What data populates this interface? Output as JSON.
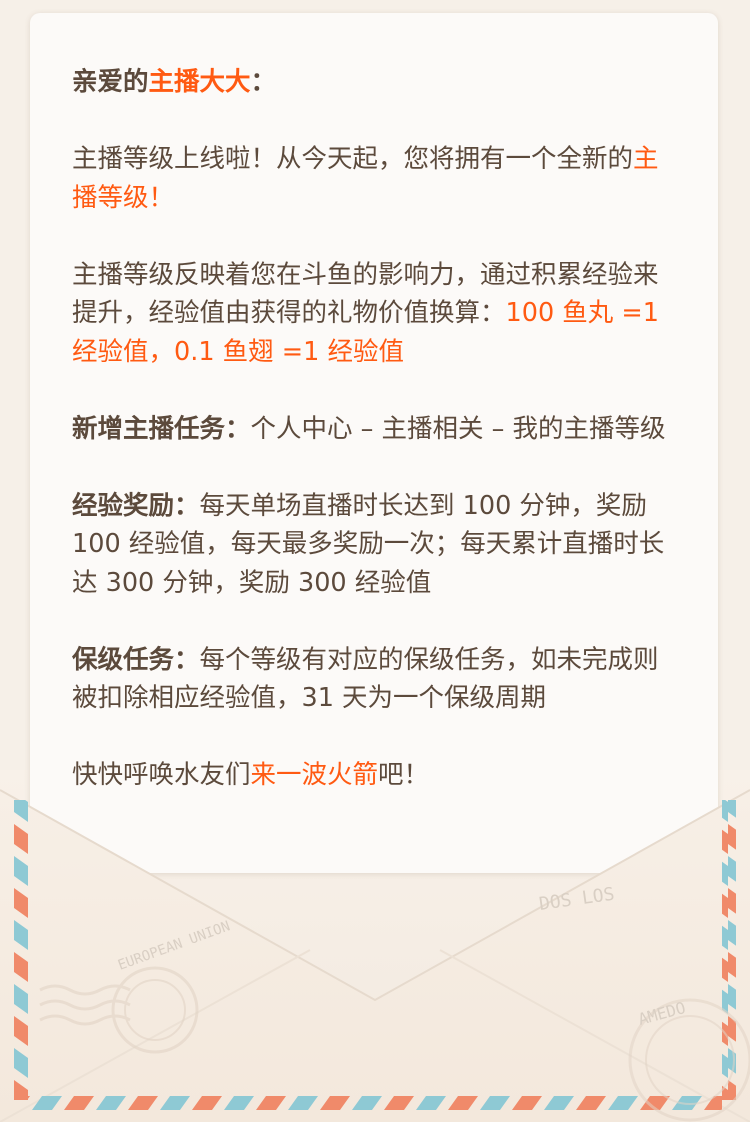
{
  "greeting": {
    "prefix": "亲爱的",
    "highlight": "主播大大",
    "suffix": "："
  },
  "intro": {
    "text": "主播等级上线啦！从今天起，您将拥有一个全新的",
    "highlight": "主播等级",
    "suffix": "！"
  },
  "explain": {
    "text": "主播等级反映着您在斗鱼的影响力，通过积累经验来提升，经验值由获得的礼物价值换算：",
    "highlight": "100 鱼丸 =1 经验值，0.1 鱼翅 =1 经验值"
  },
  "task_new": {
    "label": "新增主播任务：",
    "text": "个人中心 – 主播相关 – 我的主播等级"
  },
  "reward": {
    "label": "经验奖励：",
    "text": "每天单场直播时长达到 100 分钟，奖励 100 经验值，每天最多奖励一次；每天累计直播时长达 300 分钟，奖励 300 经验值"
  },
  "keep_level": {
    "label": "保级任务：",
    "text": "每个等级有对应的保级任务，如未完成则被扣除相应经验值，31 天为一个保级周期"
  },
  "closing": {
    "text": "快快呼唤水友们",
    "highlight": "来一波火箭",
    "suffix": "吧！"
  },
  "stamps": {
    "left_circle": "EUROPEAN UNION",
    "right_text_1": "DOS LOS",
    "right_text_2": "AMEDO"
  },
  "colors": {
    "text": "#5c4a3c",
    "highlight": "#ff5a12",
    "stripe_red": "#f08a6a",
    "stripe_blue": "#8ec9d4"
  }
}
